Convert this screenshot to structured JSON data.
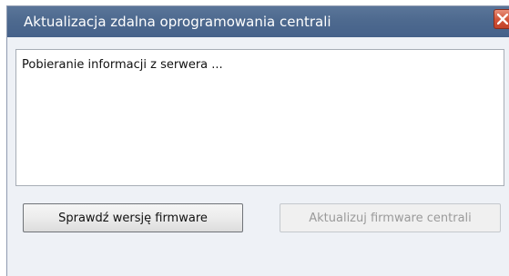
{
  "window": {
    "title": "Aktualizacja zdalna oprogramowania centrali",
    "close_icon": "close-icon"
  },
  "log": {
    "lines": [
      "Pobieranie informacji z serwera ..."
    ]
  },
  "buttons": {
    "check_label": "Sprawdź wersję firmware",
    "update_label": "Aktualizuj firmware centrali",
    "update_enabled": false
  },
  "colors": {
    "titlebar": "#4e6a8f",
    "close_button": "#c9482f",
    "dialog_background": "#eef1f6"
  }
}
